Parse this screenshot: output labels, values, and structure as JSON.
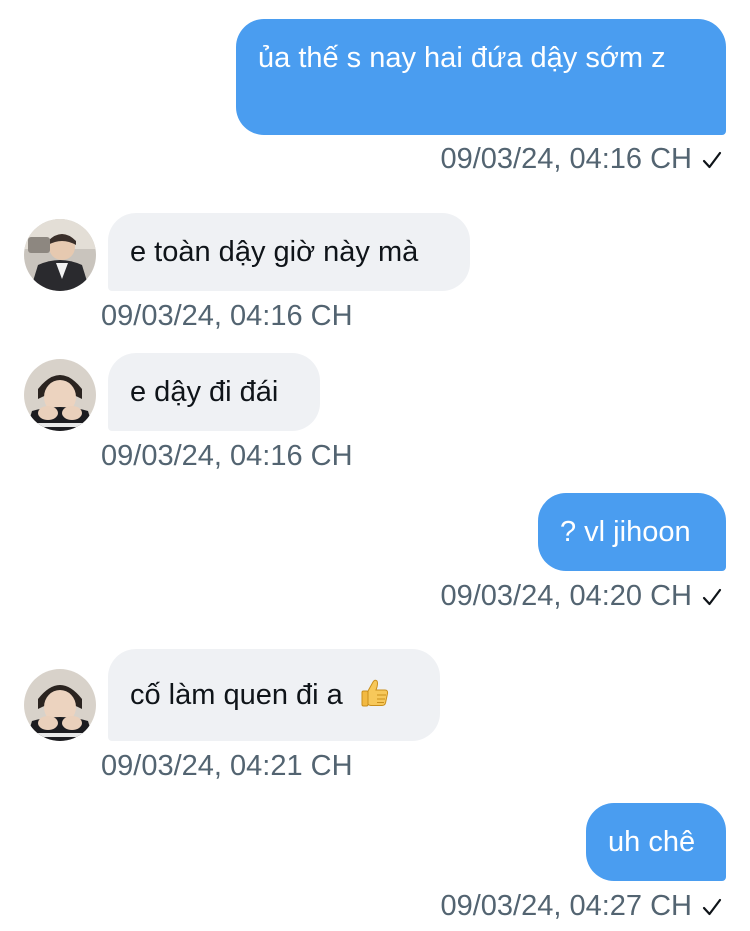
{
  "messages": [
    {
      "direction": "sent",
      "text": "ủa thế s nay hai đứa dậy sớm z",
      "timestamp": "09/03/24, 04:16 CH",
      "status_icon": "check-icon"
    },
    {
      "direction": "received",
      "text": "e toàn dậy giờ này mà",
      "timestamp": "09/03/24, 04:16 CH",
      "avatar_icon": "avatar-suit"
    },
    {
      "direction": "received",
      "text": "e dậy đi đái",
      "timestamp": "09/03/24, 04:16 CH",
      "avatar_icon": "avatar-hands"
    },
    {
      "direction": "sent",
      "text": "? vl jihoon",
      "timestamp": "09/03/24, 04:20 CH",
      "status_icon": "check-icon"
    },
    {
      "direction": "received",
      "text": "cố làm quen đi a",
      "emoji": "thumbs-up-emoji",
      "timestamp": "09/03/24, 04:21 CH",
      "avatar_icon": "avatar-hands"
    },
    {
      "direction": "sent",
      "text": "uh chê",
      "timestamp": "09/03/24, 04:27 CH",
      "status_icon": "check-icon"
    }
  ],
  "colors": {
    "sent_bubble": "#4a9df0",
    "received_bubble": "#eff1f4",
    "timestamp": "#536471"
  }
}
